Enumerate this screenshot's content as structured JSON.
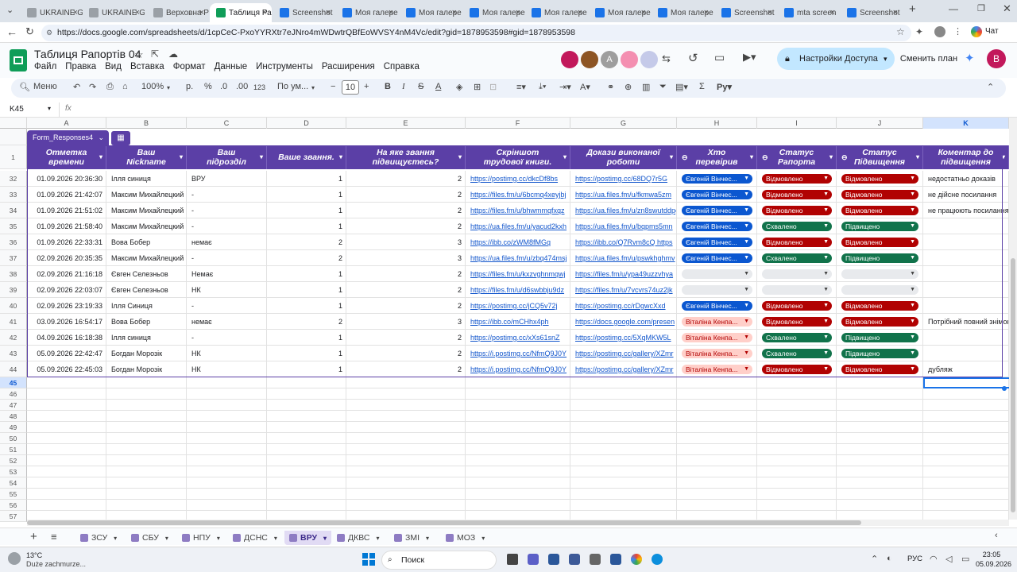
{
  "browser": {
    "tabs": [
      {
        "title": "UKRAINE G",
        "color": "#9aa0a6"
      },
      {
        "title": "UKRAINE G",
        "color": "#9aa0a6"
      },
      {
        "title": "Верховна Р",
        "color": "#9aa0a6"
      },
      {
        "title": "Таблиця Ра",
        "color": "#0f9d58"
      },
      {
        "title": "Screenshot",
        "color": "#1a73e8"
      },
      {
        "title": "Моя галере",
        "color": "#1a73e8"
      },
      {
        "title": "Моя галере",
        "color": "#1a73e8"
      },
      {
        "title": "Моя галере",
        "color": "#1a73e8"
      },
      {
        "title": "Моя галере",
        "color": "#1a73e8"
      },
      {
        "title": "Моя галере",
        "color": "#1a73e8"
      },
      {
        "title": "Моя галере",
        "color": "#1a73e8"
      },
      {
        "title": "Screenshot",
        "color": "#1a73e8"
      },
      {
        "title": "mta screen",
        "color": "#1a73e8"
      },
      {
        "title": "Screenshot",
        "color": "#1a73e8"
      }
    ],
    "url": "https://docs.google.com/spreadsheets/d/1cpCeC-PxoYYRXtr7eJNro4mWDwtrQBfEoWVSY4nM4Vc/edit?gid=1878953598#gid=1878953598",
    "chat_label": "Чат"
  },
  "doc": {
    "title": "Таблиця Рапортів 04",
    "menu": [
      "Файл",
      "Правка",
      "Вид",
      "Вставка",
      "Формат",
      "Данные",
      "Инструменты",
      "Расширения",
      "Справка"
    ],
    "share_label": "Настройки Доступа",
    "plan_label": "Сменить план",
    "avatar_letter": "B",
    "collab_letter": "A"
  },
  "toolbar": {
    "search": "Меню",
    "zoom": "100%",
    "currency": "р.",
    "percent": "%",
    "decimals": ".0",
    "dec_more": ".00",
    "numfmt": "123",
    "font": "По ум...",
    "size": "10",
    "minus": "−",
    "plus": "+"
  },
  "formula": {
    "cellref": "K45",
    "fx": "fx"
  },
  "grid": {
    "columns": [
      "A",
      "B",
      "C",
      "D",
      "E",
      "F",
      "G",
      "H",
      "I",
      "J",
      "K"
    ],
    "table_name": "Form_Responses4",
    "header_row_num": "1",
    "headers": [
      "Отметка времени",
      "Ваш Nickname",
      "Ваш підрозділ",
      "Ваше звання.",
      "На яке звання підвищуєтесь?",
      "Скріншот трудової книги.",
      "Докази виконаної роботи",
      "Хто перевірив",
      "Статус Рапорта",
      "Статус Підвищення",
      "Коментар до підвищення"
    ],
    "rows": [
      {
        "n": "32",
        "a": "01.09.2026 20:36:30",
        "b": "Ілля синиця",
        "c": "ВРУ",
        "d": "1",
        "e": "2",
        "f": "https://postimg.cc/dkcDf8bs",
        "g": "https://postimg.cc/68DQ7r5G",
        "h": "Євгеній Вінчес...",
        "hc": "blue",
        "i": "Відмовлено",
        "ic": "red",
        "j": "Відмовлено",
        "jc": "red",
        "k": "недостатньо доказів"
      },
      {
        "n": "33",
        "a": "01.09.2026 21:42:07",
        "b": "Максим Михайлецкий",
        "c": "-",
        "d": "1",
        "e": "2",
        "f": "https://files.fm/u/6bcmq4xeyjbj",
        "g": "https://ua.files.fm/u/fkmwa5zm",
        "h": "Євгеній Вінчес...",
        "hc": "blue",
        "i": "Відмовлено",
        "ic": "red",
        "j": "Відмовлено",
        "jc": "red",
        "k": "не дійсне посилання"
      },
      {
        "n": "34",
        "a": "01.09.2026 21:51:02",
        "b": "Максим Михайлецкий",
        "c": "-",
        "d": "1",
        "e": "2",
        "f": "https://files.fm/u/bhwmmqfxqz",
        "g": "https://ua.files.fm/u/zn8swutddpgt",
        "h": "Євгеній Вінчес...",
        "hc": "blue",
        "i": "Відмовлено",
        "ic": "red",
        "j": "Відмовлено",
        "jc": "red",
        "k": "не працюють посилання"
      },
      {
        "n": "35",
        "a": "01.09.2026 21:58:40",
        "b": "Максим Михайлецкий",
        "c": "-",
        "d": "1",
        "e": "2",
        "f": "https://ua.files.fm/u/yacud2kxh",
        "g": "https://ua.files.fm/u/bqpms5mn",
        "h": "Євгеній Вінчес...",
        "hc": "blue",
        "i": "Схвалено",
        "ic": "green",
        "j": "Підвищено",
        "jc": "green",
        "k": ""
      },
      {
        "n": "36",
        "a": "01.09.2026 22:33:31",
        "b": "Вова Бобер",
        "c": "немає",
        "d": "2",
        "e": "3",
        "f": "https://ibb.co/zWM8fMGq",
        "g": "https://ibb.co/Q7Rvm8cQ  https",
        "h": "Євгеній Вінчес...",
        "hc": "blue",
        "i": "Відмовлено",
        "ic": "red",
        "j": "Відмовлено",
        "jc": "red",
        "k": ""
      },
      {
        "n": "37",
        "a": "02.09.2026 20:35:35",
        "b": "Максим Михайлецкий",
        "c": "-",
        "d": "2",
        "e": "3",
        "f": "https://ua.files.fm/u/zbq474msj",
        "g": "https://ua.files.fm/u/pswkhghmv",
        "h": "Євгеній Вінчес...",
        "hc": "blue",
        "i": "Схвалено",
        "ic": "green",
        "j": "Підвищено",
        "jc": "green",
        "k": ""
      },
      {
        "n": "38",
        "a": "02.09.2026 21:16:18",
        "b": "Євген Селезньов",
        "c": "Немає",
        "d": "1",
        "e": "2",
        "f": "https://files.fm/u/kxzvghnmqwj",
        "g": "https://files.fm/u/ypa49uzzvhya",
        "h": "",
        "hc": "grey",
        "i": "",
        "ic": "grey",
        "j": "",
        "jc": "grey",
        "k": ""
      },
      {
        "n": "39",
        "a": "02.09.2026 22:03:07",
        "b": "Євген Селезньов",
        "c": "НК",
        "d": "1",
        "e": "2",
        "f": "https://files.fm/u/d6swbbju9dz",
        "g": "https://files.fm/u/7vcvrs74uz2jk",
        "h": "",
        "hc": "grey",
        "i": "",
        "ic": "grey",
        "j": "",
        "jc": "grey",
        "k": ""
      },
      {
        "n": "40",
        "a": "02.09.2026 23:19:33",
        "b": "Ілля Синиця",
        "c": "-",
        "d": "1",
        "e": "2",
        "f": "https://postimg.cc/jCQ5v72j",
        "g": "https://postimg.cc/rDgwcXxd",
        "h": "Євгеній Вінчес...",
        "hc": "blue",
        "i": "Відмовлено",
        "ic": "red",
        "j": "Відмовлено",
        "jc": "red",
        "k": ""
      },
      {
        "n": "41",
        "a": "03.09.2026 16:54:17",
        "b": "Вова Бобер",
        "c": "немає",
        "d": "2",
        "e": "3",
        "f": "https://ibb.co/mCHhx4ph",
        "g": "https://docs.google.com/presen",
        "h": "Віталіна Кенпа...",
        "hc": "pink",
        "i": "Відмовлено",
        "ic": "red",
        "j": "Відмовлено",
        "jc": "red",
        "k": "Потрібний повний знімок"
      },
      {
        "n": "42",
        "a": "04.09.2026 16:18:38",
        "b": "Ілля синиця",
        "c": "-",
        "d": "1",
        "e": "2",
        "f": "https://postimg.cc/xXs61snZ",
        "g": "https://postimg.cc/5XqMKW5L",
        "h": "Віталіна Кенпа...",
        "hc": "pink",
        "i": "Схвалено",
        "ic": "green",
        "j": "Підвищено",
        "jc": "green",
        "k": ""
      },
      {
        "n": "43",
        "a": "05.09.2026 22:42:47",
        "b": "Богдан Морозік",
        "c": "НК",
        "d": "1",
        "e": "2",
        "f": "https://i.postimg.cc/NfmQ9J0Y",
        "g": "https://postimg.cc/gallery/XZmr",
        "h": "Віталіна Кенпа...",
        "hc": "pink",
        "i": "Схвалено",
        "ic": "green",
        "j": "Підвищено",
        "jc": "green",
        "k": ""
      },
      {
        "n": "44",
        "a": "05.09.2026 22:45:03",
        "b": "Богдан Морозік",
        "c": "НК",
        "d": "1",
        "e": "2",
        "f": "https://i.postimg.cc/NfmQ9J0Y",
        "g": "https://postimg.cc/gallery/XZmr",
        "h": "Віталіна Кенпа...",
        "hc": "pink",
        "i": "Відмовлено",
        "ic": "red",
        "j": "Відмовлено",
        "jc": "red",
        "k": "дубляж"
      }
    ],
    "empty_rows": [
      "45",
      "46",
      "47",
      "48",
      "49",
      "50",
      "51",
      "52",
      "53",
      "54",
      "55",
      "56",
      "57"
    ]
  },
  "sheets": [
    "ЗСУ",
    "СБУ",
    "НПУ",
    "ДСНС",
    "ВРУ",
    "ДКВС",
    "ЗМІ",
    "МОЗ"
  ],
  "active_sheet": "ВРУ",
  "taskbar": {
    "weather_temp": "13°C",
    "weather_desc": "Duże zachmurze...",
    "search": "Поиск",
    "lang": "РУС",
    "time": "23:05",
    "date": "05.09.2026"
  }
}
